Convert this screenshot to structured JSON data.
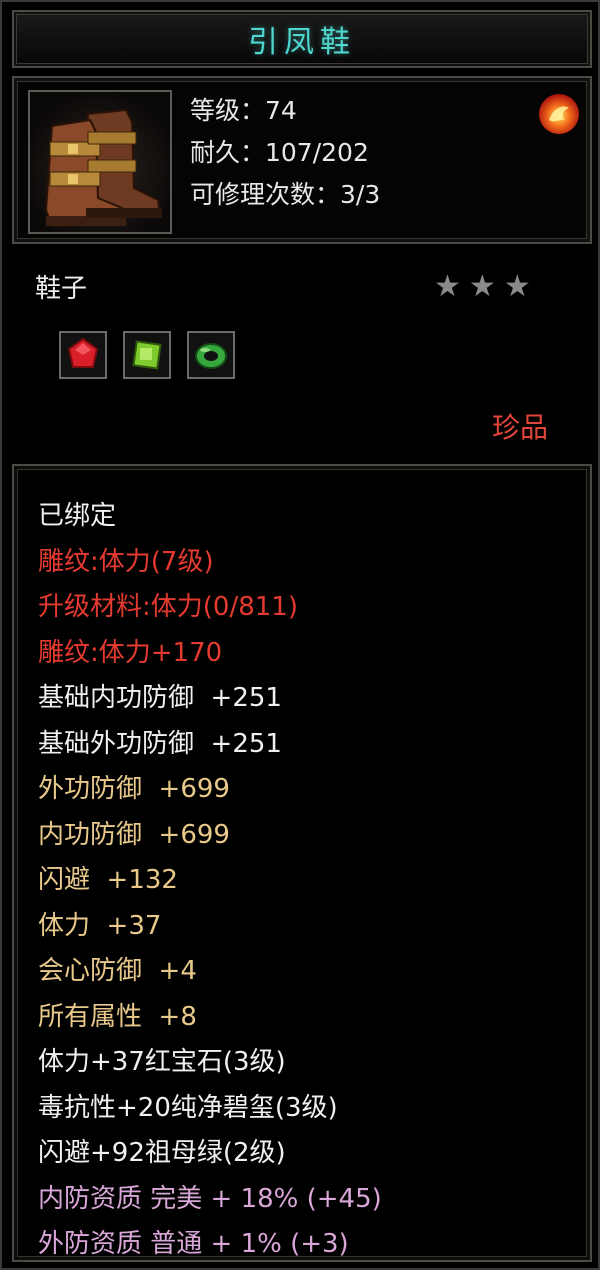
{
  "item": {
    "name": "引凤鞋",
    "level": "等级：74",
    "durability": "耐久：107/202",
    "repairs": "可修理次数：3/3",
    "type": "鞋子",
    "stars": [
      "★",
      "★",
      "★"
    ],
    "rarity": "珍品"
  },
  "gems": [
    {
      "name": "ruby-gem-icon",
      "color": "#d81f2a"
    },
    {
      "name": "emerald-gem-icon",
      "color": "#7ecb2e"
    },
    {
      "name": "jade-ring-gem-icon",
      "color": "#36a83c"
    }
  ],
  "attributes": [
    {
      "text": "已绑定",
      "color": "white"
    },
    {
      "text": "雕纹:体力(7级)",
      "color": "red"
    },
    {
      "text": "升级材料:体力(0/811)",
      "color": "red"
    },
    {
      "text": "雕纹:体力+170",
      "color": "red"
    },
    {
      "text": "基础内功防御  +251",
      "color": "white"
    },
    {
      "text": "基础外功防御  +251",
      "color": "white"
    },
    {
      "text": "外功防御  +699",
      "color": "gold"
    },
    {
      "text": "内功防御  +699",
      "color": "gold"
    },
    {
      "text": "闪避  +132",
      "color": "gold"
    },
    {
      "text": "体力  +37",
      "color": "gold"
    },
    {
      "text": "会心防御  +4",
      "color": "gold"
    },
    {
      "text": "所有属性  +8",
      "color": "gold"
    },
    {
      "text": "体力+37红宝石(3级)",
      "color": "white"
    },
    {
      "text": "毒抗性+20纯净碧玺(3级)",
      "color": "white"
    },
    {
      "text": "闪避+92祖母绿(2级)",
      "color": "white"
    },
    {
      "text": "内防资质 完美 + 18% (+45)",
      "color": "pink"
    },
    {
      "text": "外防资质 普通 + 1% (+3)",
      "color": "pink"
    }
  ]
}
